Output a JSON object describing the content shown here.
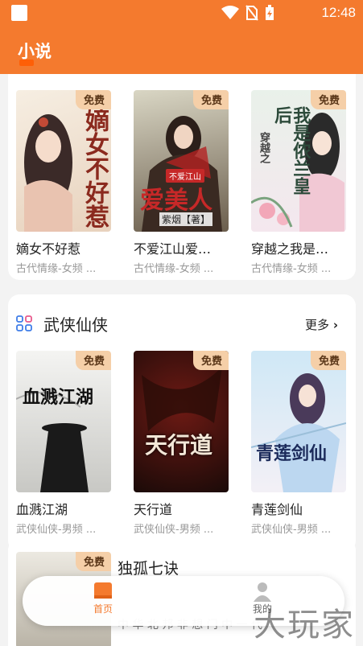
{
  "status_bar": {
    "time": "12:48"
  },
  "header": {
    "title": "小说"
  },
  "free_label": "免费",
  "row1": [
    {
      "title": "嫡女不好惹",
      "sub": "古代情缘-女频 ...",
      "cover_text": "嫡女不好惹"
    },
    {
      "title": "不爱江山爱…",
      "sub": "古代情缘-女频 ...",
      "cover_text": "不爱江山",
      "cover_author": "紫烟【著】",
      "cover_text2": "爱美人"
    },
    {
      "title": "穿越之我是…",
      "sub": "古代情缘-女频 ...",
      "cover_text": "我是侬兰皇后",
      "cover_text2": "穿越之"
    }
  ],
  "section2": {
    "title": "武侠仙侠",
    "more": "更多",
    "books": [
      {
        "title": "血溅江湖",
        "sub": "武侠仙侠-男频 ...",
        "cover_text": "血溅江湖"
      },
      {
        "title": "天行道",
        "sub": "武侠仙侠-男频 ...",
        "cover_text": "天行道"
      },
      {
        "title": "青莲剑仙",
        "sub": "武侠仙侠-男频 ...",
        "cover_text": "青莲剑仙"
      }
    ]
  },
  "section3": {
    "title": "独孤七诀",
    "desc": "中 华 北 邦 非 想 门 中 一 代"
  },
  "nav": {
    "home": "首页",
    "me": "我的"
  },
  "watermark": "大玩家",
  "colors": {
    "brand": "#f47a2e",
    "badge": "#f5cfa8"
  }
}
